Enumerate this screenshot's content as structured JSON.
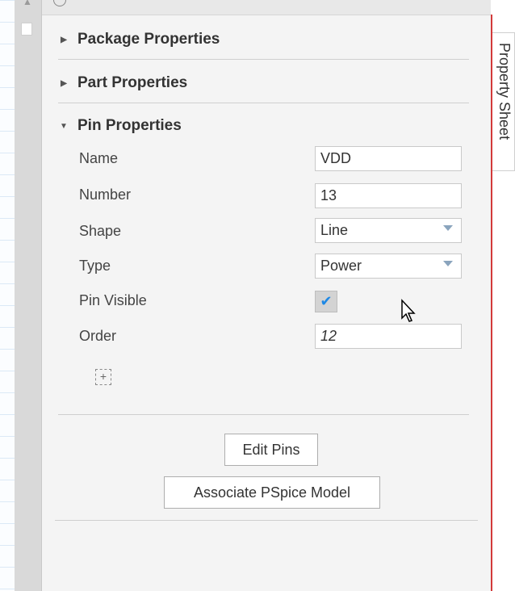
{
  "sections": {
    "package": {
      "label": "Package Properties"
    },
    "part": {
      "label": "Part Properties"
    },
    "pin": {
      "label": "Pin Properties"
    }
  },
  "pin_properties": {
    "name": {
      "label": "Name",
      "value": "VDD"
    },
    "number": {
      "label": "Number",
      "value": "13"
    },
    "shape": {
      "label": "Shape",
      "value": "Line"
    },
    "type": {
      "label": "Type",
      "value": "Power"
    },
    "pin_visible": {
      "label": "Pin Visible",
      "checked": true
    },
    "order": {
      "label": "Order",
      "value": "12"
    }
  },
  "buttons": {
    "edit_pins": "Edit Pins",
    "associate_pspice": "Associate PSpice Model"
  },
  "side_tab": {
    "label": "Property Sheet"
  },
  "colors": {
    "accent": "#d33a3a",
    "check": "#1e88e5"
  }
}
